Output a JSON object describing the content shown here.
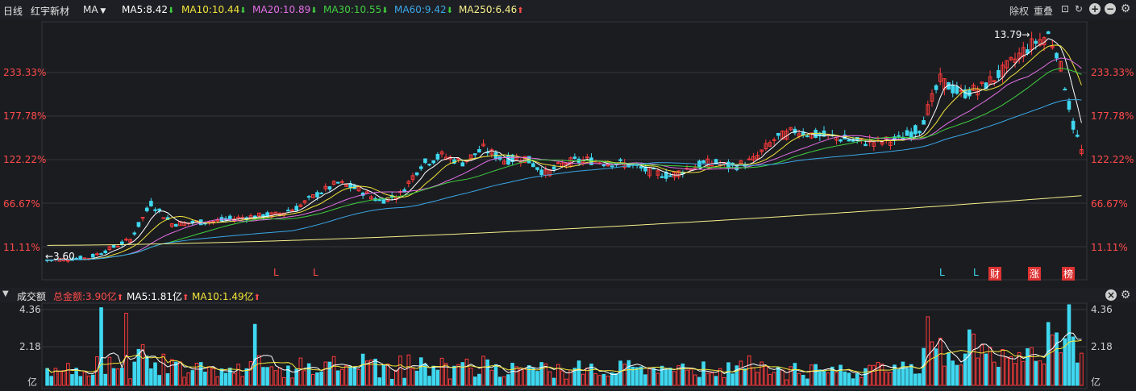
{
  "toolbar": {
    "period": "日线",
    "stock_name": "红宇新材",
    "indicator": "MA",
    "ma": [
      {
        "label": "MA5:8.42",
        "dir": "down",
        "color": "#ffffff"
      },
      {
        "label": "MA10:10.44",
        "dir": "down",
        "color": "#f2e53a"
      },
      {
        "label": "MA20:10.89",
        "dir": "down",
        "color": "#e36fe6"
      },
      {
        "label": "MA30:10.55",
        "dir": "down",
        "color": "#3fd03f"
      },
      {
        "label": "MA60:9.42",
        "dir": "down",
        "color": "#3aa8e8"
      },
      {
        "label": "MA250:6.46",
        "dir": "up",
        "color": "#f6f08a"
      }
    ],
    "right": {
      "chuquan": "除权",
      "chongdie": "重叠"
    }
  },
  "price_axis": {
    "ticks": [
      "233.33%",
      "177.78%",
      "122.22%",
      "66.67%",
      "11.11%"
    ],
    "max_label": "13.79→",
    "min_label": "←3.60"
  },
  "markers": [
    "L",
    "L",
    "L",
    "L",
    "财",
    "涨",
    "榜"
  ],
  "volume": {
    "title": "成交额",
    "total": "总金额:3.90亿",
    "ma5": "MA5:1.81亿",
    "ma10": "MA10:1.49亿",
    "ticks": [
      "4.36",
      "2.18",
      "亿"
    ]
  },
  "colors": {
    "up": "#ff3b3b",
    "down": "#3fd8f0",
    "bg": "#1b1c20",
    "grid": "#34363c"
  },
  "chart_data": {
    "type": "candlestick",
    "title": "红宇新材 日线",
    "n_days": 250,
    "price_high": 13.79,
    "price_low": 3.6,
    "y_axis": "percent",
    "y_ticks": [
      11.11,
      66.67,
      122.22,
      177.78,
      233.33
    ],
    "volume_ticks": [
      2.18,
      4.36
    ],
    "volume_unit": "亿",
    "note": "Candles are approximated; indicator lines MA5/MA10/MA20/MA30/MA60/MA250 drawn."
  }
}
